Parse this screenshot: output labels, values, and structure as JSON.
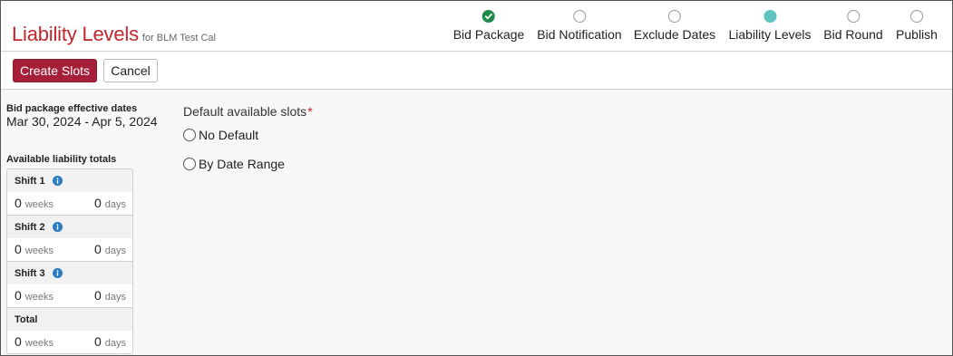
{
  "header": {
    "title": "Liability Levels",
    "subtitle": "for BLM Test Cal"
  },
  "stepper": {
    "steps": [
      {
        "label": "Bid Package",
        "state": "done"
      },
      {
        "label": "Bid Notification",
        "state": "pending"
      },
      {
        "label": "Exclude Dates",
        "state": "pending"
      },
      {
        "label": "Liability Levels",
        "state": "current"
      },
      {
        "label": "Bid Round",
        "state": "pending"
      },
      {
        "label": "Publish",
        "state": "pending"
      }
    ]
  },
  "toolbar": {
    "create_label": "Create Slots",
    "cancel_label": "Cancel"
  },
  "package": {
    "dates_label": "Bid package effective dates",
    "dates_value": "Mar 30, 2024 - Apr 5, 2024"
  },
  "totals": {
    "label": "Available liability totals",
    "weeks_unit": "weeks",
    "days_unit": "days",
    "groups": [
      {
        "name": "Shift 1",
        "weeks": "0",
        "days": "0",
        "info": true
      },
      {
        "name": "Shift 2",
        "weeks": "0",
        "days": "0",
        "info": true
      },
      {
        "name": "Shift 3",
        "weeks": "0",
        "days": "0",
        "info": true
      },
      {
        "name": "Total",
        "weeks": "0",
        "days": "0",
        "info": false
      }
    ]
  },
  "form": {
    "default_slots_label": "Default available slots",
    "required_marker": "*",
    "options": [
      {
        "label": "No Default",
        "selected": false
      },
      {
        "label": "By Date Range",
        "selected": false
      }
    ]
  },
  "colors": {
    "brand_red": "#c0272d",
    "primary_button": "#a51f38",
    "step_done": "#1e8a4a",
    "step_current": "#5fc4c0",
    "info_blue": "#2a7bc0"
  },
  "icons": {
    "step_done": "checkmark-icon",
    "info": "info-icon"
  }
}
